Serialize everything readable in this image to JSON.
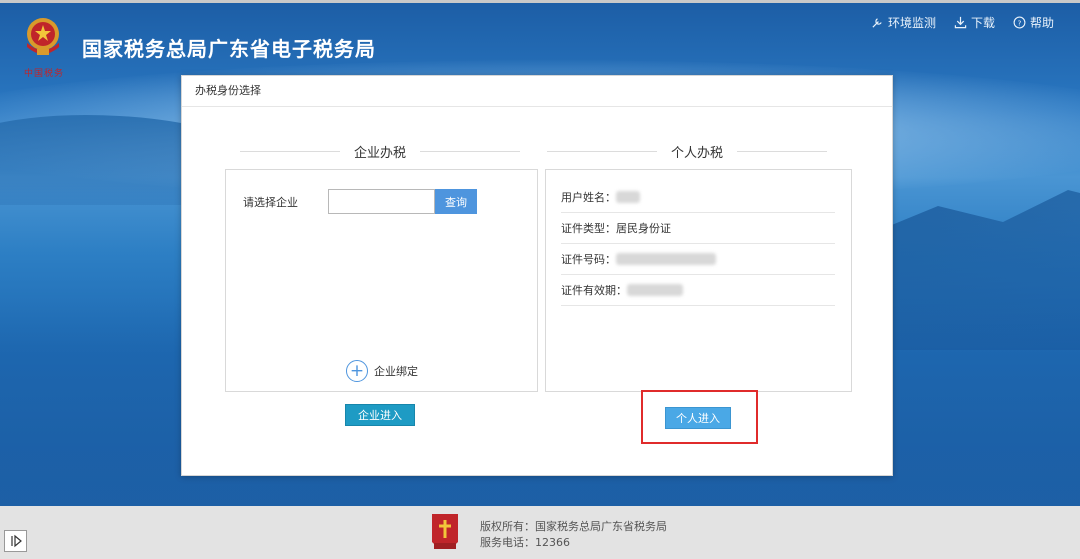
{
  "header": {
    "site_title": "国家税务总局广东省电子税务局",
    "logo_text": "中国税务",
    "links": [
      {
        "label": "环境监测",
        "icon": "tool-icon"
      },
      {
        "label": "下载",
        "icon": "download-icon"
      },
      {
        "label": "帮助",
        "icon": "help-icon"
      }
    ]
  },
  "dialog": {
    "title": "办税身份选择",
    "company": {
      "section_title": "企业办税",
      "select_label": "请选择企业",
      "select_value": "",
      "query_button": "查询",
      "bind_label": "企业绑定",
      "enter_button": "企业进入"
    },
    "personal": {
      "section_title": "个人办税",
      "fields": [
        {
          "label": "用户姓名：",
          "value": ""
        },
        {
          "label": "证件类型：",
          "value": "居民身份证"
        },
        {
          "label": "证件号码：",
          "value": ""
        },
        {
          "label": "证件有效期：",
          "value": ""
        }
      ],
      "enter_button": "个人进入"
    }
  },
  "footer": {
    "copyright": "版权所有：国家税务总局广东省税务局",
    "phone": "服务电话：12366",
    "badge_text": "党政机关"
  },
  "colors": {
    "query_button": "#4e95de",
    "company_enter": "#1e9bc4",
    "person_enter": "#4aa8e6",
    "highlight": "#e02b2b"
  }
}
